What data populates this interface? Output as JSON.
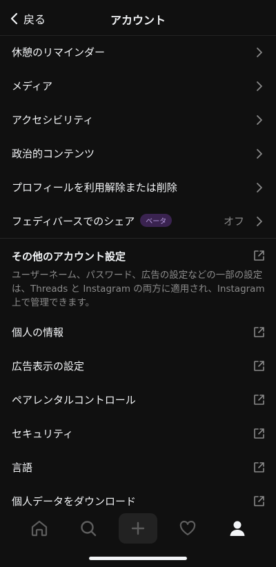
{
  "header": {
    "back_label": "戻る",
    "title": "アカウント"
  },
  "menu_items": [
    {
      "label": "休憩のリマインダー"
    },
    {
      "label": "メディア"
    },
    {
      "label": "アクセシビリティ"
    },
    {
      "label": "政治的コンテンツ"
    },
    {
      "label": "プロフィールを利用解除または削除"
    },
    {
      "label": "フェディバースでのシェア",
      "badge": "ベータ",
      "value": "オフ"
    }
  ],
  "other_settings": {
    "title": "その他のアカウント設定",
    "description": "ユーザーネーム、パスワード、広告の設定などの一部の設定は、Threads と Instagram の両方に適用され、Instagram 上で管理できます。",
    "items": [
      {
        "label": "個人の情報"
      },
      {
        "label": "広告表示の設定"
      },
      {
        "label": "ペアレンタルコントロール"
      },
      {
        "label": "セキュリティ"
      },
      {
        "label": "言語"
      },
      {
        "label": "個人データをダウンロード"
      }
    ]
  },
  "nav": {
    "icons": [
      "home-icon",
      "search-icon",
      "plus-icon",
      "heart-icon",
      "profile-icon"
    ]
  },
  "colors": {
    "background": "#101010",
    "text": "#f3f5f7",
    "muted": "#8b8b8b",
    "badge_bg": "#3a2350",
    "badge_text": "#b79de0"
  }
}
